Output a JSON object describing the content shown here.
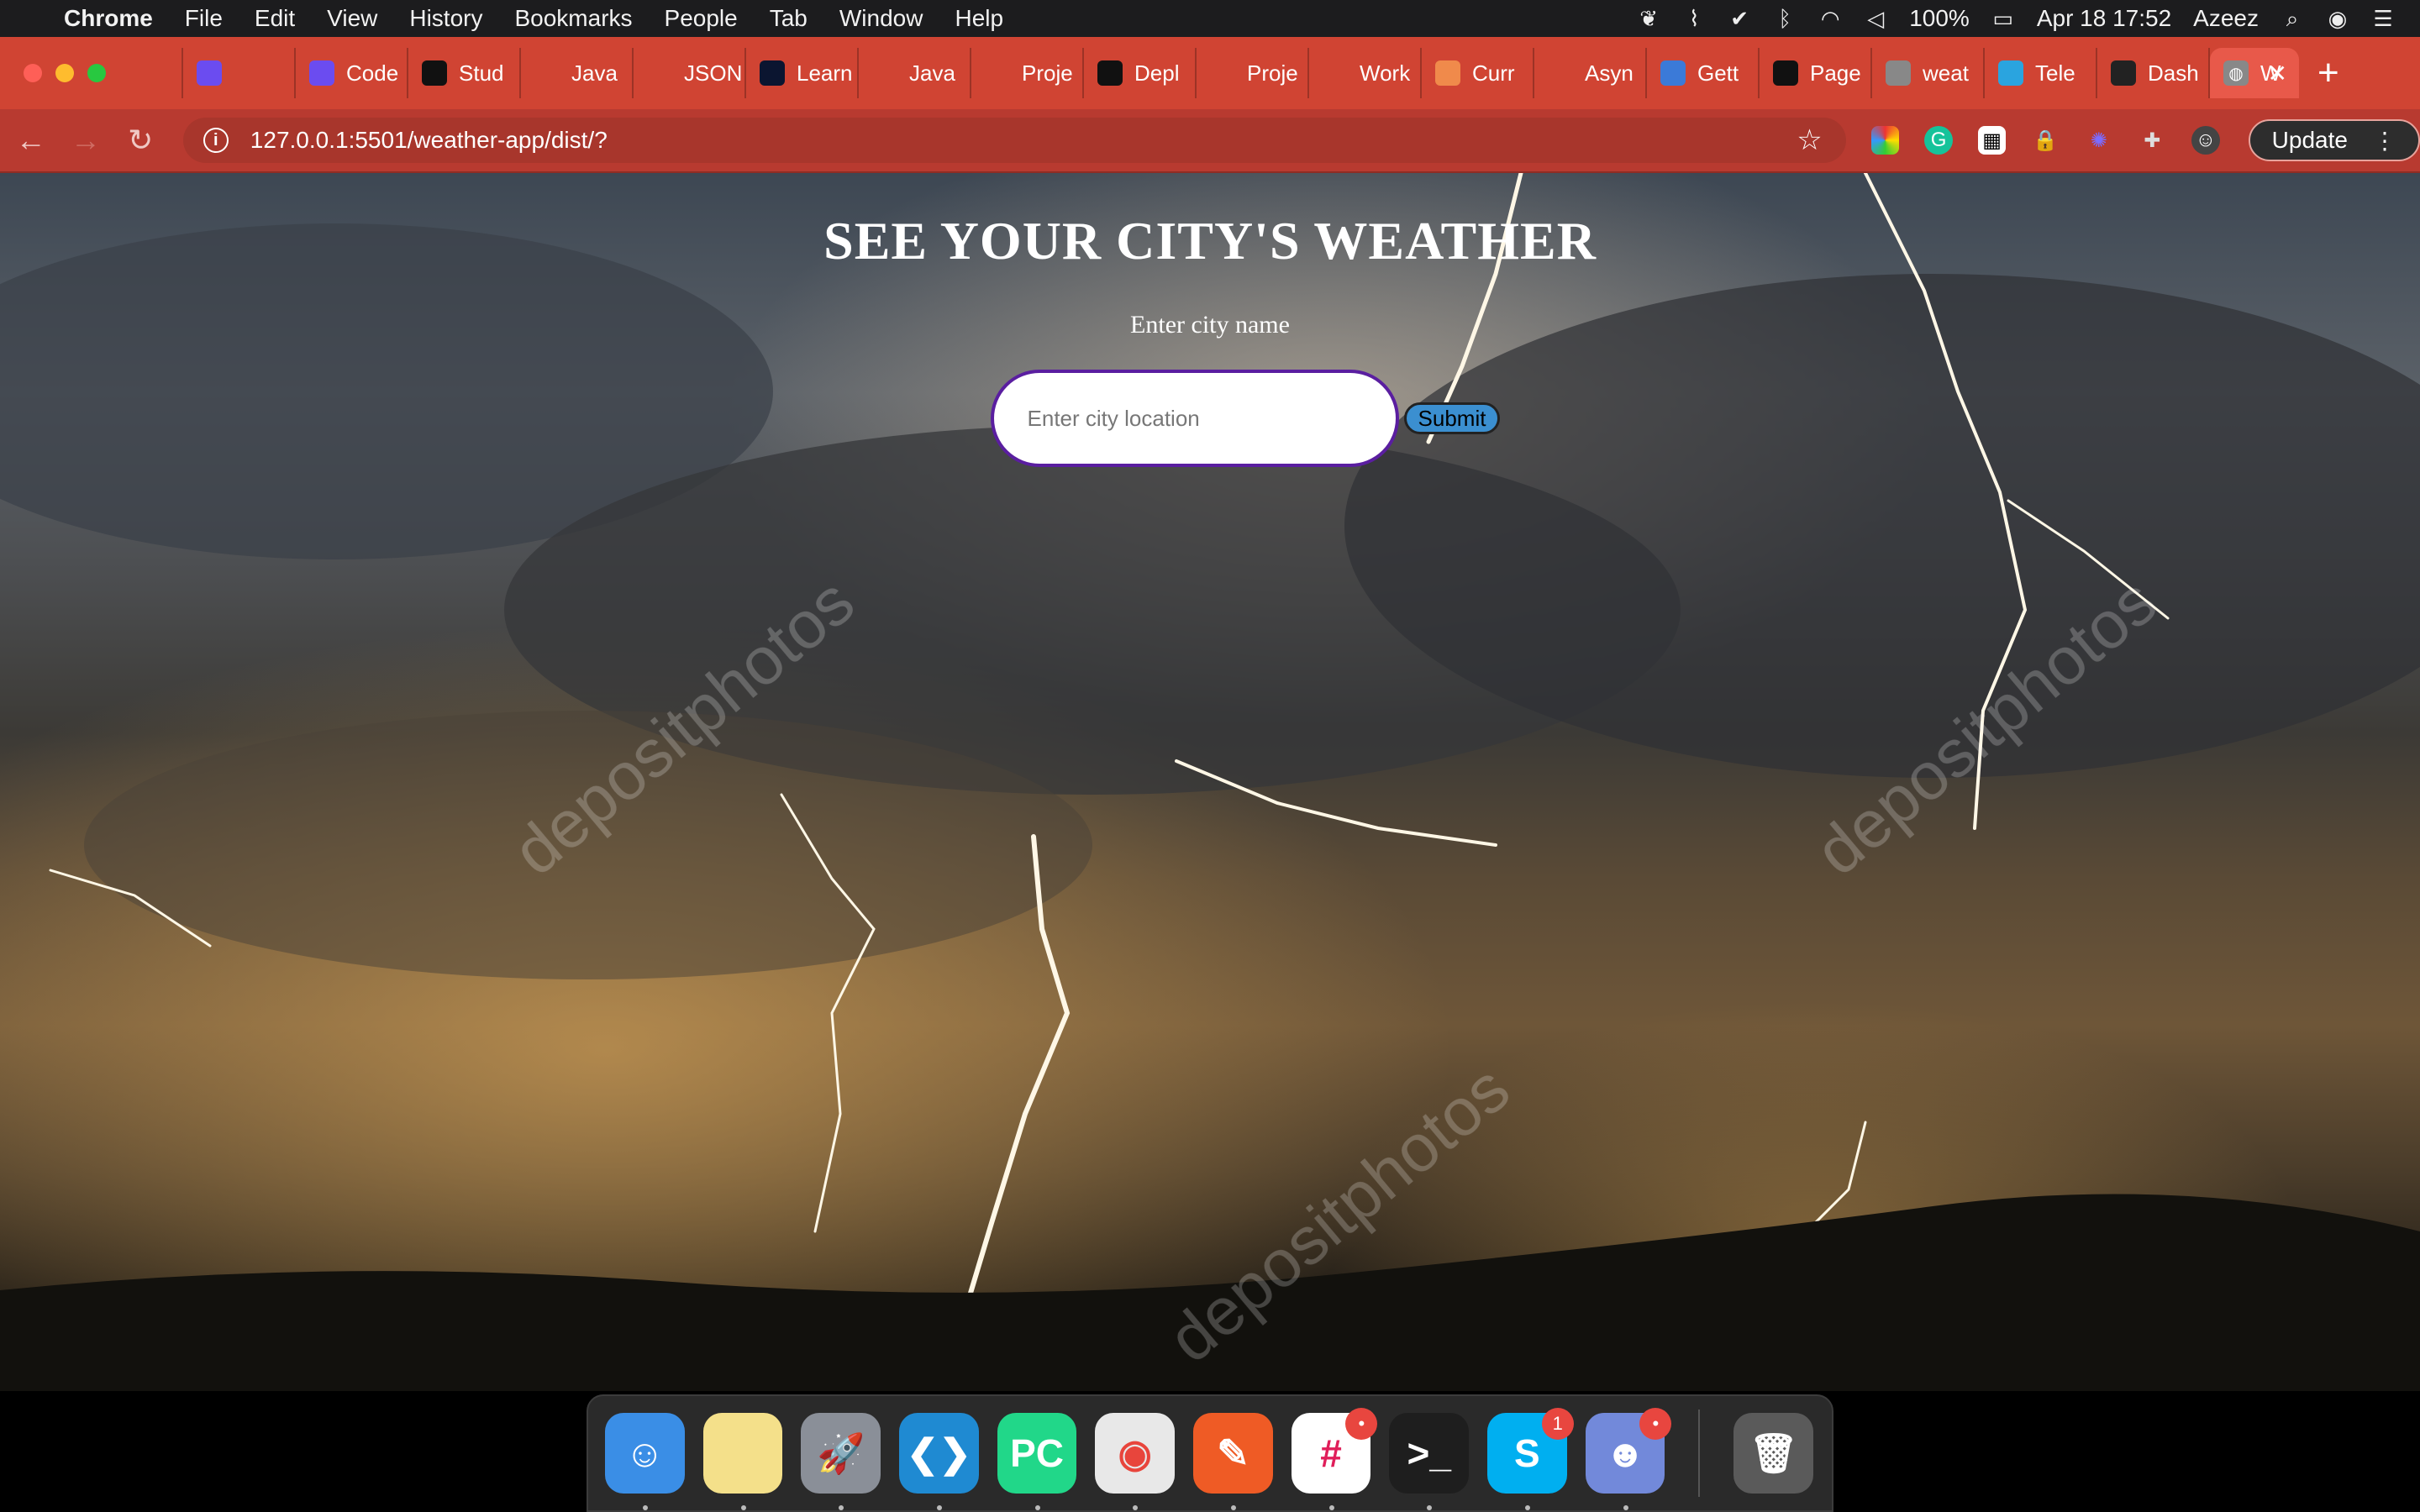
{
  "menubar": {
    "app_name": "Chrome",
    "menus": [
      "File",
      "Edit",
      "View",
      "History",
      "Bookmarks",
      "People",
      "Tab",
      "Window",
      "Help"
    ],
    "battery": "100%",
    "datetime": "Apr 18  17:52",
    "user": "Azeez"
  },
  "tabs": [
    {
      "label": "",
      "icon": "reload-icon",
      "color": "#d04433"
    },
    {
      "label": "",
      "icon": "codemo-icon",
      "color": "#6b4cf0"
    },
    {
      "label": "Code",
      "icon": "codemo-icon",
      "color": "#6b4cf0"
    },
    {
      "label": "Stud",
      "icon": "github-icon",
      "color": "#111111"
    },
    {
      "label": "Java",
      "icon": "codemo-icon",
      "color": "#d04433"
    },
    {
      "label": "JSON",
      "icon": "bookmark-icon",
      "color": "#d04433"
    },
    {
      "label": "Learn",
      "icon": "code-icon",
      "color": "#0b1530"
    },
    {
      "label": "Java",
      "icon": "codemo-icon",
      "color": "#d04433"
    },
    {
      "label": "Proje",
      "icon": "bookmark-icon",
      "color": "#d04433"
    },
    {
      "label": "Depl",
      "icon": "github-icon",
      "color": "#111111"
    },
    {
      "label": "Proje",
      "icon": "bookmark-icon",
      "color": "#d04433"
    },
    {
      "label": "Work",
      "icon": "bookmark-icon",
      "color": "#d04433"
    },
    {
      "label": "Curr",
      "icon": "cloud-icon",
      "color": "#f08a4b"
    },
    {
      "label": "Asyn",
      "icon": "bookmark-icon",
      "color": "#d04433"
    },
    {
      "label": "Gett",
      "icon": "cube-icon",
      "color": "#3b7ad8"
    },
    {
      "label": "Page",
      "icon": "github-icon",
      "color": "#111111"
    },
    {
      "label": "weat",
      "icon": "globe-icon",
      "color": "#888888"
    },
    {
      "label": "Tele",
      "icon": "telegram-icon",
      "color": "#2aa4df"
    },
    {
      "label": "Dash",
      "icon": "check-circle-icon",
      "color": "#222222"
    }
  ],
  "active_tab": {
    "label": "W",
    "icon": "globe-icon"
  },
  "address_bar": {
    "url": "127.0.0.1:5501/weather-app/dist/?"
  },
  "update_label": "Update",
  "page": {
    "heading": "SEE YOUR CITY'S WEATHER",
    "city_label": "Enter city name",
    "input_placeholder": "Enter city location",
    "input_value": "",
    "submit_label": "Submit",
    "watermark": "depositphotos"
  },
  "dock": [
    {
      "name": "finder",
      "color": "#3a8ee6",
      "glyph": "☺",
      "badge": ""
    },
    {
      "name": "notes",
      "color": "#f4e08a",
      "glyph": "",
      "badge": ""
    },
    {
      "name": "launchpad",
      "color": "#8a8f98",
      "glyph": "🚀",
      "badge": ""
    },
    {
      "name": "vscode",
      "color": "#1f8ad2",
      "glyph": "❮❯",
      "badge": ""
    },
    {
      "name": "pycharm",
      "color": "#21d789",
      "glyph": "PC",
      "badge": ""
    },
    {
      "name": "chrome",
      "color": "#e8e8e8",
      "glyph": "◉",
      "badge": ""
    },
    {
      "name": "postman",
      "color": "#ef5b25",
      "glyph": "✎",
      "badge": ""
    },
    {
      "name": "slack",
      "color": "#ffffff",
      "glyph": "#",
      "badge": "•"
    },
    {
      "name": "terminal",
      "color": "#1e1e1e",
      "glyph": ">_",
      "badge": ""
    },
    {
      "name": "skype",
      "color": "#00aff0",
      "glyph": "S",
      "badge": "1"
    },
    {
      "name": "discord",
      "color": "#7289da",
      "glyph": "☻",
      "badge": "•"
    },
    {
      "name": "trash",
      "color": "#5a5a5a",
      "glyph": "🗑",
      "badge": ""
    }
  ]
}
